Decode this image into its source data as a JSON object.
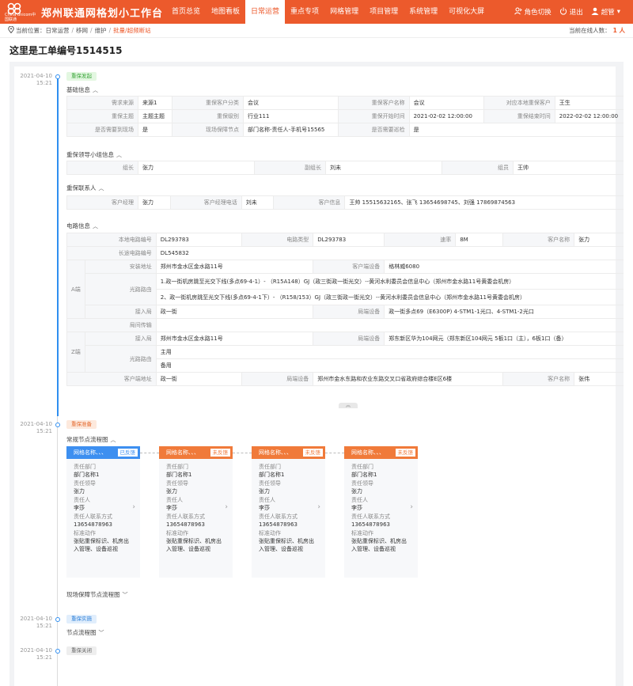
{
  "header": {
    "logo_sub": "China unicom中国联通",
    "title": "郑州联通网格划小工作台",
    "nav": [
      "首页总览",
      "地图看板",
      "日常运营",
      "重点专项",
      "网格管理",
      "项目管理",
      "系统管理",
      "可视化大屏"
    ],
    "active_index": 2,
    "switch_role": "角色切换",
    "logout": "退出",
    "user": "超管"
  },
  "breadcrumb": {
    "prefix": "当前位置：",
    "items": [
      "日常运营",
      "移网",
      "维护",
      "批量/超频断站"
    ],
    "online_label": "当前在线人数：",
    "online_count": "1 人"
  },
  "page_title": "这里是工单编号1514515",
  "timeline": [
    {
      "date": "2021-04-10",
      "time": "15:21",
      "tag": "重保发起"
    },
    {
      "date": "2021-04-10",
      "time": "15:21",
      "tag": "重保准备"
    },
    {
      "date": "2021-04-10",
      "time": "15:21",
      "tag": "重保实施"
    },
    {
      "date": "2021-04-10",
      "time": "15:21",
      "tag": "重保关闭"
    }
  ],
  "sections": {
    "basic": "基础信息",
    "leader_group": "重保领导小组信息",
    "contacts": "重保联系人",
    "circuit": "电路信息",
    "flow": "常规节点流程图",
    "onsite": "现场保障节点流程图",
    "node_flow": "节点流程图"
  },
  "basic_info": [
    [
      [
        "需求来源",
        "来源1"
      ],
      [
        "重保客户分类",
        "会议"
      ],
      [
        "重保客户名称",
        "会议"
      ],
      [
        "对应本地重保客户",
        "王生"
      ]
    ],
    [
      [
        "重保主题",
        "主题主题"
      ],
      [
        "重保级别",
        "行业111"
      ],
      [
        "重保开始时间",
        "2021-02-02 12:00:00"
      ],
      [
        "重保结束时间",
        "2022-02-02 12:00:00"
      ]
    ],
    [
      [
        "是否需要到现场",
        "是"
      ],
      [
        "现场保障节点",
        "部门名称-责任人-手机号15565"
      ],
      [
        "是否需要巡检",
        "是"
      ]
    ]
  ],
  "leader_info": [
    [
      "组长",
      "张力"
    ],
    [
      "副组长",
      "刘未"
    ],
    [
      "组员",
      "王帅"
    ]
  ],
  "contact_info": [
    [
      "客户经理",
      "张力"
    ],
    [
      "客户经理电话",
      "刘未"
    ],
    [
      "客户信息",
      "王帅 15515632165、张飞 13654698745、刘强 17869874563"
    ]
  ],
  "circuit": {
    "row1": [
      [
        "本地电路编号",
        "DL293783"
      ],
      [
        "电路类型",
        "DL293783"
      ],
      [
        "速率",
        "8M"
      ],
      [
        "客户名称",
        "张力"
      ]
    ],
    "long_circuit": [
      "长途电路编号",
      "DL545832"
    ],
    "a_side": "A端",
    "a_addr": [
      "安装地址",
      "郑州市金水区金水路11号"
    ],
    "a_cust_dev": [
      "客户端设备",
      "格林威6080"
    ],
    "route_label": "光路路由",
    "a_route1": "1.政一街机房跳至光交下线(多点69-4-1）-  （R15A148）GJ（政三街政一街光交）--黄河水利委员会信息中心（郑州市金水路11号黄委会机房）",
    "a_route2": "2、政一街机房跳至光交下线(多点69-4-1下）-  （R158/153）GJ（政三街政一街光交）--黄河水利委员会信息中心（郑州市金水路11号黄委会机房）",
    "a_office": [
      "接入局",
      "政一街"
    ],
    "a_office_dev": [
      "局端设备",
      "政一街多点69（E6300P) 4-STM1-1光口、4-STM1-2光口"
    ],
    "transfer": "局间传输",
    "z_side": "Z端",
    "z_office": [
      "接入局",
      "郑州市金水区金水路11号"
    ],
    "z_office_dev": [
      "局端设备",
      "郑东新区华为104网元（郑东新区104网元 5板1口（主），6板1口（备）"
    ],
    "z_main": "主用",
    "z_backup": "备用",
    "last_row": [
      [
        "客户端地址",
        "政一街"
      ],
      [
        "局端设备",
        "郑州市金水东路和农业东路交叉口省政府综合楼E区6楼"
      ],
      [
        "客户名称",
        "张伟"
      ]
    ]
  },
  "flow_cards": [
    {
      "name": "网格名称、、、",
      "status": "已反馈",
      "color": "blue",
      "dept_label": "责任部门",
      "dept": "部门名称1",
      "leader_label": "责任领导",
      "leader": "张力",
      "owner_label": "责任人",
      "owner": "李莎",
      "phone_label": "责任人联系方式",
      "phone": "13654878963",
      "action_label": "标准动作",
      "action1": "张贴重保标识、机房出",
      "action2": "入管理、设备巡视"
    },
    {
      "name": "网格名称、、、",
      "status": "未反馈",
      "color": "orange",
      "dept_label": "责任部门",
      "dept": "部门名称1",
      "leader_label": "责任领导",
      "leader": "张力",
      "owner_label": "责任人",
      "owner": "李莎",
      "phone_label": "责任人联系方式",
      "phone": "13654878963",
      "action_label": "标准动作",
      "action1": "张贴重保标识、机房出",
      "action2": "入管理、设备巡视"
    },
    {
      "name": "网格名称、、、",
      "status": "未反馈",
      "color": "orange",
      "dept_label": "责任部门",
      "dept": "部门名称1",
      "leader_label": "责任领导",
      "leader": "张力",
      "owner_label": "责任人",
      "owner": "李莎",
      "phone_label": "责任人联系方式",
      "phone": "13654878963",
      "action_label": "标准动作",
      "action1": "张贴重保标识、机房出",
      "action2": "入管理、设备巡视"
    },
    {
      "name": "网格名称、、、",
      "status": "未反馈",
      "color": "orange",
      "dept_label": "责任部门",
      "dept": "部门名称1",
      "leader_label": "责任领导",
      "leader": "张力",
      "owner_label": "责任人",
      "owner": "李莎",
      "phone_label": "责任人联系方式",
      "phone": "13654878963",
      "action_label": "标准动作",
      "action1": "张贴重保标识、机房出",
      "action2": "入管理、设备巡视"
    }
  ],
  "colors": {
    "brand": "#ec5a2c",
    "accent": "#2f8ef0"
  }
}
